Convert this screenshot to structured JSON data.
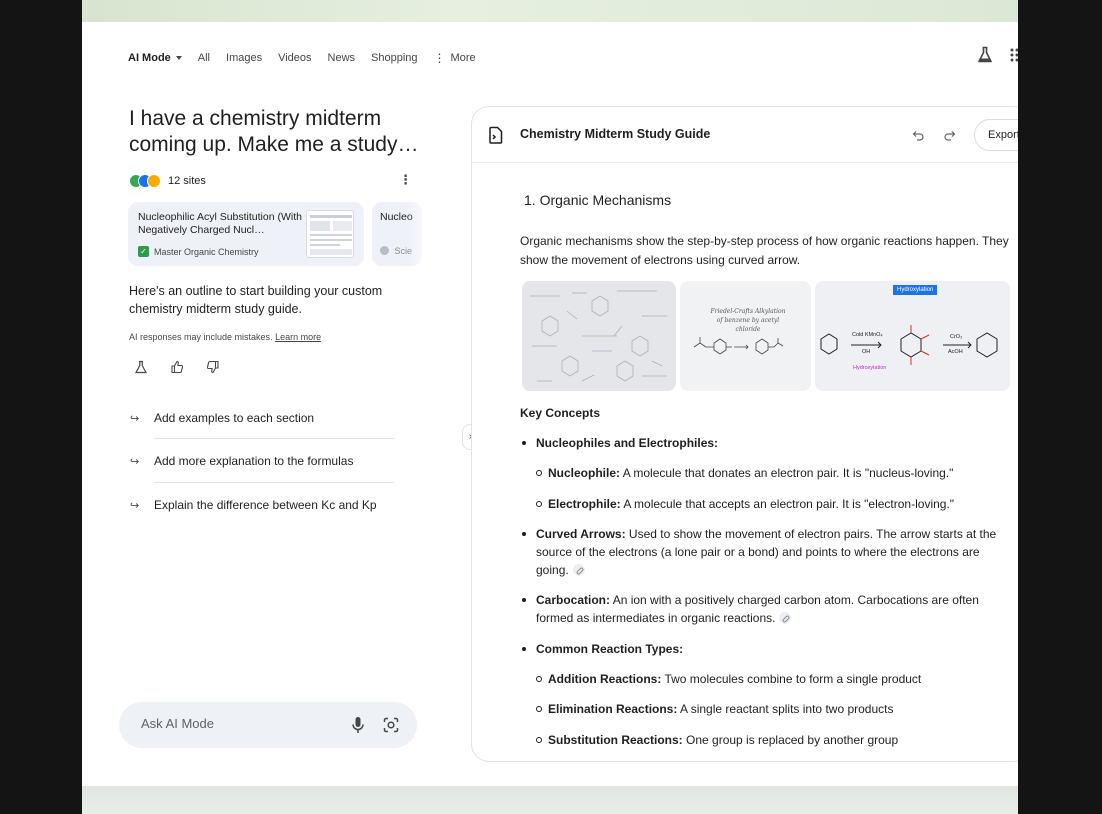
{
  "nav": {
    "tabs": [
      "AI Mode",
      "All",
      "Images",
      "Videos",
      "News",
      "Shopping",
      "More"
    ]
  },
  "query": "I have a chemistry midterm coming up. Make me a study…",
  "sources": {
    "count_label": "12 sites",
    "dot_colors": [
      "#34a853",
      "#1a73e8",
      "#f9ab00"
    ],
    "cards": [
      {
        "title": "Nucleophilic Acyl Substitution (With Negatively Charged Nucl…",
        "source": "Master Organic Chemistry"
      },
      {
        "title": "Nucleo",
        "source": "Scie"
      }
    ]
  },
  "answer": {
    "intro": "Here's an outline to start building your custom chemistry midterm study guide.",
    "disclaimer": "AI responses may include mistakes.",
    "learn_more": "Learn more"
  },
  "suggestions": [
    "Add examples to each section",
    "Add more explanation to the formulas",
    "Explain the difference between Kc and Kp"
  ],
  "ask": {
    "placeholder": "Ask AI Mode"
  },
  "panel": {
    "title": "Chemistry Midterm Study Guide",
    "export_label": "Export",
    "section_number": "1.",
    "section_title": "Organic Mechanisms",
    "paragraph": "Organic mechanisms show the step-by-step process of how organic reactions happen. They show the movement of electrons using curved arrow.",
    "images": {
      "img2_caption": "Friedel-Crafts Alkylation of benzene by acetyl chloride",
      "img3_badge": "Hydroxylation",
      "img3_reagent1": "Cold KMnO₄",
      "img3_reagent1b": "OH",
      "img3_label": "Hydroxylation",
      "img3_reagent2": "CrO₃",
      "img3_reagent2b": "AcOH"
    },
    "key_concepts": "Key Concepts",
    "bullets": {
      "nucleo_electro": "Nucleophiles and Electrophiles:",
      "nucleophile_term": "Nucleophile:",
      "nucleophile_def": "A molecule that donates an electron pair. It is \"nucleus-loving.\"",
      "electrophile_term": "Electrophile:",
      "electrophile_def": "A molecule that accepts an electron pair. It is \"electron-loving.\"",
      "curved_term": "Curved Arrows:",
      "curved_def": "Used to show the movement of electron pairs. The arrow starts at the source of the electrons (a lone pair or a bond) and points to where the electrons are going.",
      "carbocation_term": "Carbocation:",
      "carbocation_def": "An ion with a positively charged carbon atom. Carbocations are often formed as intermediates in organic reactions.",
      "common_types": "Common Reaction Types:",
      "addition_term": "Addition Reactions:",
      "addition_def": "Two molecules combine to form a single product",
      "elimination_term": "Elimination Reactions:",
      "elimination_def": "A single reactant splits into two products",
      "substitution_term": "Substitution Reactions:",
      "substitution_def": "One group is replaced by another group"
    }
  }
}
